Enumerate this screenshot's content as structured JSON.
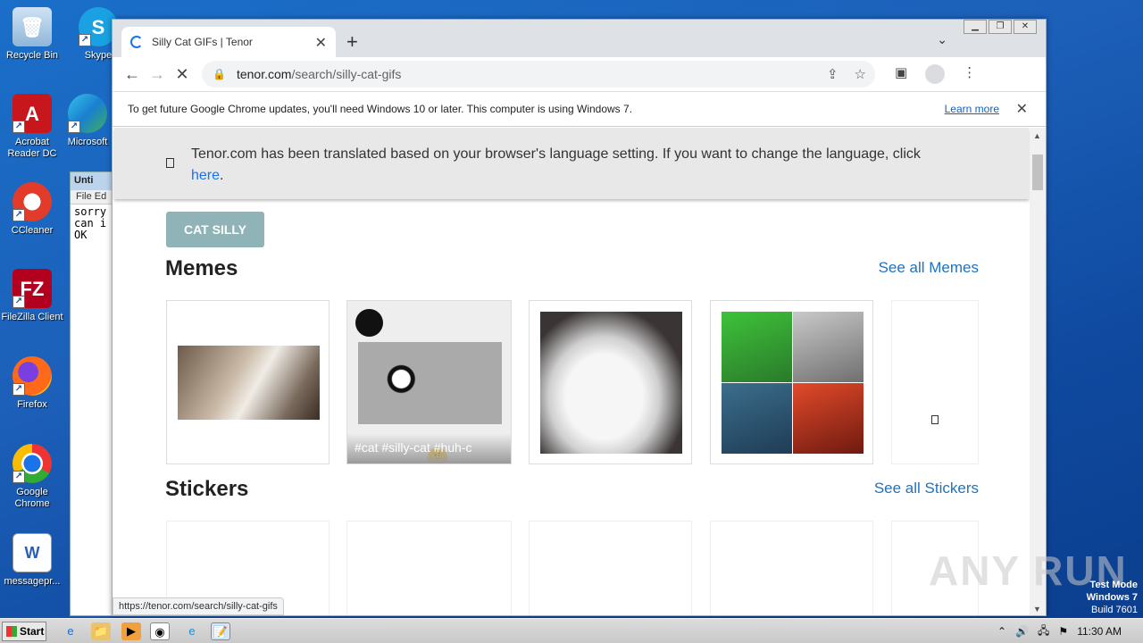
{
  "desktop": {
    "icons": [
      {
        "label": "Recycle Bin"
      },
      {
        "label": "Skype"
      },
      {
        "label": "Acrobat Reader DC"
      },
      {
        "label": "Microsoft"
      },
      {
        "label": "CCleaner"
      },
      {
        "label": "FileZilla Client"
      },
      {
        "label": "Firefox"
      },
      {
        "label": "Google Chrome"
      },
      {
        "label": "messagepr..."
      }
    ]
  },
  "notepad": {
    "title": "Unti",
    "menu": "File  Ed",
    "text": "sorry\ncan i\nOK"
  },
  "browser": {
    "tab_title": "Silly Cat GIFs | Tenor",
    "url_host": "tenor.com",
    "url_path": "/search/silly-cat-gifs",
    "infobar_text": "To get future Google Chrome updates, you'll need Windows 10 or later. This computer is using Windows 7.",
    "infobar_link": "Learn more",
    "status_url": "https://tenor.com/search/silly-cat-gifs"
  },
  "page": {
    "translate_text": "Tenor.com has been translated based on your browser's language setting. If you want to change the language, click",
    "translate_link": "here",
    "translate_tail": ".",
    "pill": "CAT SILLY",
    "memes_title": "Memes",
    "memes_see_all": "See all Memes",
    "stickers_title": "Stickers",
    "stickers_see_all": "See all Stickers",
    "meme_tags": "#cat  #silly-cat  #huh-c"
  },
  "overlay": {
    "watermark": "ANY  RUN",
    "test_mode": "Test Mode",
    "os": "Windows 7",
    "build": "Build 7601"
  },
  "taskbar": {
    "start": "Start",
    "time": "11:30 AM"
  }
}
